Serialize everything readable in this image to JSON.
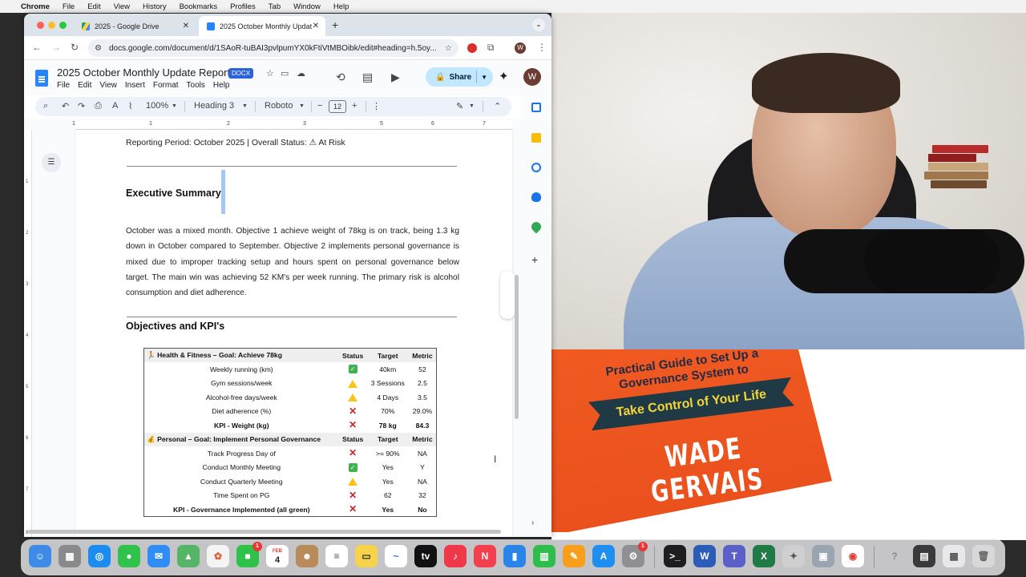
{
  "menubar": {
    "app": "Chrome",
    "items": [
      "File",
      "Edit",
      "View",
      "History",
      "Bookmarks",
      "Profiles",
      "Tab",
      "Window",
      "Help"
    ]
  },
  "browser": {
    "tabs": [
      {
        "title": "2025 - Google Drive",
        "active": false,
        "icon": "google-drive-icon"
      },
      {
        "title": "2025 October Monthly Updat",
        "active": true,
        "icon": "google-docs-icon"
      }
    ],
    "url": "docs.google.com/document/d/1SAoR-tuBAI3pvlpumYX0kFtiVtMBOibk/edit#heading=h.5oy..."
  },
  "docs": {
    "title": "2025 October  Monthly Update Report",
    "badge": "DOCX",
    "menu": [
      "File",
      "Edit",
      "View",
      "Insert",
      "Format",
      "Tools",
      "Help"
    ],
    "share_label": "Share",
    "user_initial": "W",
    "toolbar": {
      "zoom": "100%",
      "style": "Heading 3",
      "font": "Roboto",
      "font_size": "12"
    },
    "ruler_numbers": [
      "1",
      "1",
      "2",
      "3",
      "4",
      "5",
      "6",
      "7"
    ],
    "vruler_numbers": [
      "1",
      "2",
      "3",
      "4",
      "5",
      "6",
      "7",
      "8"
    ]
  },
  "document": {
    "reporting_line": "Reporting Period: October 2025 | Overall Status: ⚠ At Risk",
    "executive_heading": "Executive Summary",
    "executive_paragraph": "October was a mixed month. Objective 1 achieve weight of 78kg  is on track, being 1.3 kg down in October compared to September.  Objective 2 implements personal governance is mixed due to improper tracking setup and hours spent on personal governance below target. The main win was  achieving 52 KM's per week running. The primary risk is alcohol consumption and diet adherence.",
    "objectives_heading": "Objectives and KPI's",
    "table": {
      "sections": [
        {
          "header": {
            "label": "🏃 Health & Fitness – Goal: Achieve 78kg",
            "status": "Status",
            "target": "Target",
            "metric": "Metric"
          },
          "rows": [
            {
              "name": "Weekly running (km)",
              "status": "green",
              "target": "40km",
              "metric": "52",
              "bold": false
            },
            {
              "name": "Gym sessions/week",
              "status": "warn",
              "target": "3 Sessions",
              "metric": "2.5",
              "bold": false
            },
            {
              "name": "Alcohol-free days/week",
              "status": "warn",
              "target": "4 Days",
              "metric": "3.5",
              "bold": false
            },
            {
              "name": "Diet adherence (%)",
              "status": "red",
              "target": "70%",
              "metric": "29.0%",
              "bold": false
            },
            {
              "name": "KPI - Weight (kg)",
              "status": "red",
              "target": "78 kg",
              "metric": "84.3",
              "bold": true
            }
          ]
        },
        {
          "header": {
            "label": "💰 Personal – Goal: Implement Personal Governance",
            "status": "Status",
            "target": "Target",
            "metric": "Metric"
          },
          "rows": [
            {
              "name": "Track Progress Day of",
              "status": "red",
              "target": ">= 90%",
              "metric": "NA",
              "bold": false
            },
            {
              "name": "Conduct Monthly Meeting",
              "status": "green",
              "target": "Yes",
              "metric": "Y",
              "bold": false
            },
            {
              "name": "Conduct Quarterly Meeting",
              "status": "warn",
              "target": "Yes",
              "metric": "NA",
              "bold": false
            },
            {
              "name": "Time Spent on PG",
              "status": "red",
              "target": "62",
              "metric": "32",
              "bold": false
            },
            {
              "name": "KPI - Governance Implemented (all green)",
              "status": "red",
              "target": "Yes",
              "metric": "No",
              "bold": true
            }
          ]
        }
      ]
    }
  },
  "promo": {
    "line1": "Practical Guide to Set Up a",
    "line2": "Governance System to",
    "ribbon": "Take Control of Your Life",
    "author": "WADE GERVAIS"
  },
  "dock": {
    "calendar_month": "FEB",
    "calendar_day": "4",
    "facetime_badge": "1",
    "settings_badge": "1"
  }
}
